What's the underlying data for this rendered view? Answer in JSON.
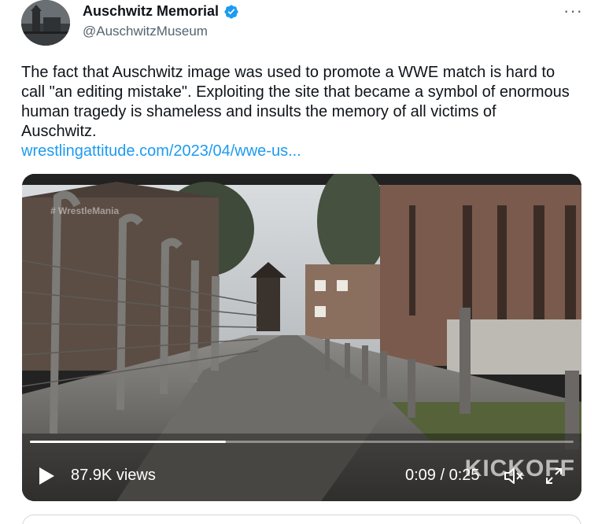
{
  "author": {
    "display_name": "Auschwitz Memorial",
    "handle": "@AuschwitzMuseum",
    "verified_icon": "verified-badge-icon",
    "avatar_icon": "avatar"
  },
  "menu": {
    "icon": "more-options-icon",
    "label": "···"
  },
  "tweet": {
    "text": "The fact that Auschwitz image was used to promote a WWE match is hard to call \"an editing mistake\". Exploiting the site that became a symbol of enormous human tragedy is shameless and insults the memory of all victims of Auschwitz.",
    "link": "wrestlingattitude.com/2023/04/wwe-us..."
  },
  "video": {
    "watermark_tag": "# WrestleMania",
    "watermark_brand": "KICKOFF",
    "views": "87.9K views",
    "time": "0:09 / 0:25",
    "progress": 0.36,
    "colors": {
      "accent": "#1d9bf0",
      "verified": "#1d9bf0"
    }
  }
}
